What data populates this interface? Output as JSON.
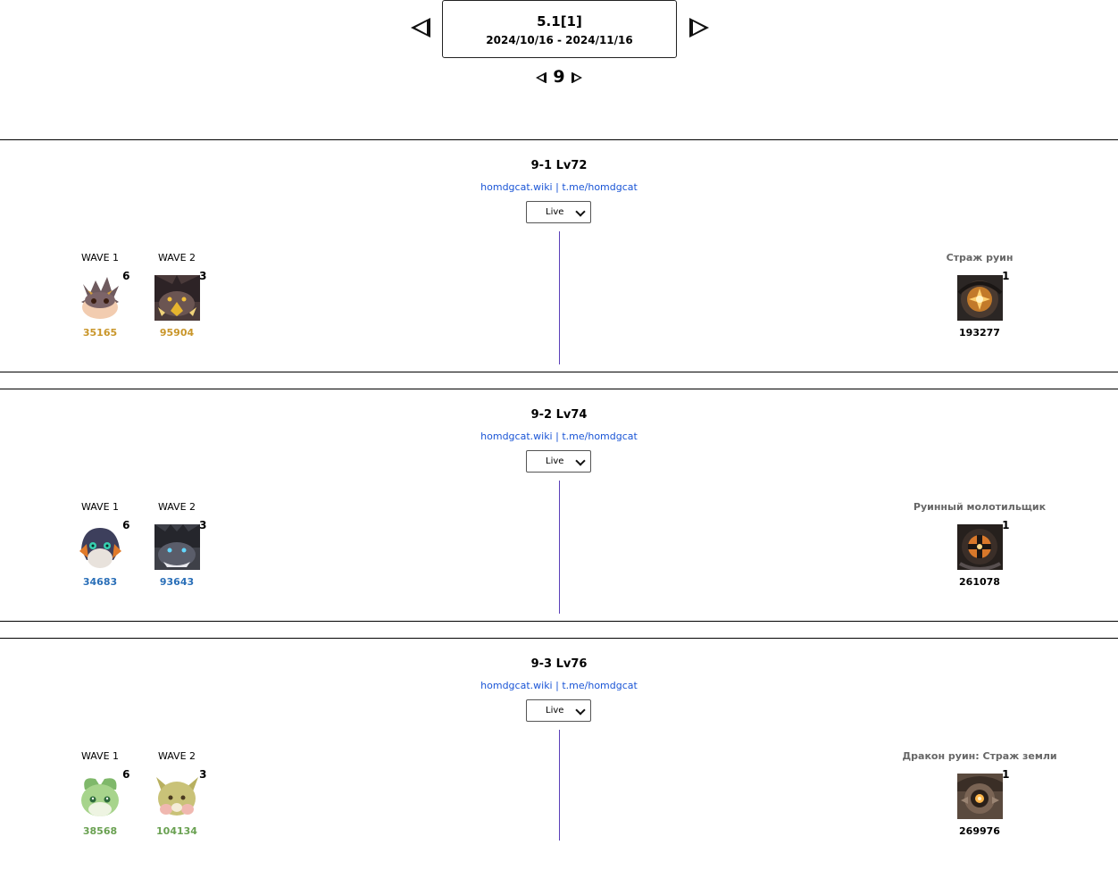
{
  "header": {
    "version": "5.1[1]",
    "dates": "2024/10/16 - 2024/11/16",
    "chapter": "9"
  },
  "stages": [
    {
      "title": "9-1 Lv72",
      "link1": "homdgcat.wiki",
      "separator": "|",
      "link2": "t.me/homdgcat",
      "select_value": "Live",
      "waves": [
        {
          "label": "WAVE 1",
          "count": "6",
          "hp": "35165",
          "icon": "ruin-beast-brown-icon"
        },
        {
          "label": "WAVE 2",
          "count": "3",
          "hp": "95904",
          "icon": "ruin-beast-dark-icon"
        }
      ],
      "hp_color": "#c9962a",
      "boss": {
        "name": "Страж руин",
        "count": "1",
        "hp": "193277",
        "icon": "ruin-guard-icon"
      }
    },
    {
      "title": "9-2 Lv74",
      "link1": "homdgcat.wiki",
      "separator": "|",
      "link2": "t.me/homdgcat",
      "select_value": "Live",
      "waves": [
        {
          "label": "WAVE 1",
          "count": "6",
          "hp": "34683",
          "icon": "ruin-beast-blue-icon"
        },
        {
          "label": "WAVE 2",
          "count": "3",
          "hp": "93643",
          "icon": "ruin-beast-grey-icon"
        }
      ],
      "hp_color": "#2a6fb8",
      "boss": {
        "name": "Руинный молотильщик",
        "count": "1",
        "hp": "261078",
        "icon": "ruin-grader-icon"
      }
    },
    {
      "title": "9-3 Lv76",
      "link1": "homdgcat.wiki",
      "separator": "|",
      "link2": "t.me/homdgcat",
      "select_value": "Live",
      "waves": [
        {
          "label": "WAVE 1",
          "count": "6",
          "hp": "38568",
          "icon": "ruin-beast-green-icon"
        },
        {
          "label": "WAVE 2",
          "count": "3",
          "hp": "104134",
          "icon": "ruin-beast-olive-icon"
        }
      ],
      "hp_color": "#6aa152",
      "boss": {
        "name": "Дракон руин: Страж земли",
        "count": "1",
        "hp": "269976",
        "icon": "ruin-drake-icon"
      }
    }
  ]
}
